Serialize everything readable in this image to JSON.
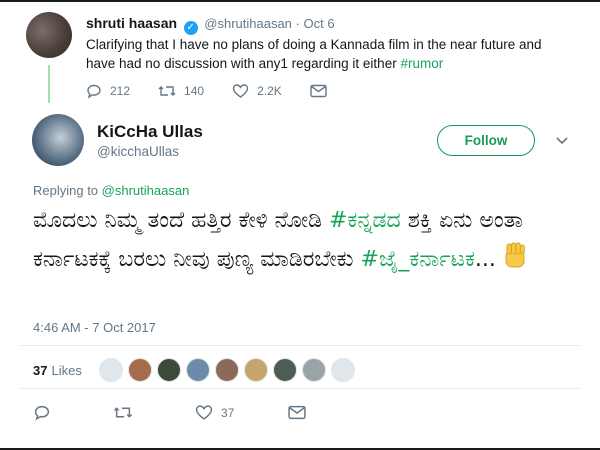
{
  "tweet1": {
    "display_name": "shruti haasan",
    "handle": "@shrutihaasan",
    "separator": "·",
    "date": "Oct 6",
    "text": "Clarifying that I have no plans of doing a Kannada film in the near future and have had no discussion with any1 regarding it either",
    "hashtag": "#rumor",
    "replies": "212",
    "retweets": "140",
    "likes": "2.2K"
  },
  "tweet2": {
    "display_name": "KiCcHa Ullas",
    "handle": "@kicchaUllas",
    "follow_label": "Follow",
    "replying_prefix": "Replying to",
    "replying_handle": "@shrutihaasan",
    "text_part1": "ಮೊದಲು ನಿಮ್ಮ ತಂದೆ ಹತ್ತಿರ ಕೇಳಿ ನೋಡಿ ",
    "hashtag1": "#ಕನ್ನಡದ",
    "text_part2": " ಶಕ್ತಿ ಏನು ಅಂತಾ ಕರ್ನಾಟಕಕ್ಕೆ ಬರಲು ನೀವು ಪುಣ್ಯ ಮಾಡಿರಬೇಕು ",
    "hashtag2": "#ಜೈ_ಕರ್ನಾಟಕ",
    "text_part3": "...",
    "timestamp": "4:46 AM - 7 Oct 2017",
    "likes_count": "37",
    "likes_label": "Likes",
    "footer_likes": "37"
  },
  "colors": {
    "accent_green": "#17a35a",
    "muted": "#657786",
    "verified_blue": "#1da1f2",
    "thread_line": "#a7e0a7"
  },
  "icons": [
    "verified-icon",
    "reply-icon",
    "retweet-icon",
    "like-icon",
    "message-icon",
    "chevron-down-icon",
    "raised-fist-emoji"
  ]
}
